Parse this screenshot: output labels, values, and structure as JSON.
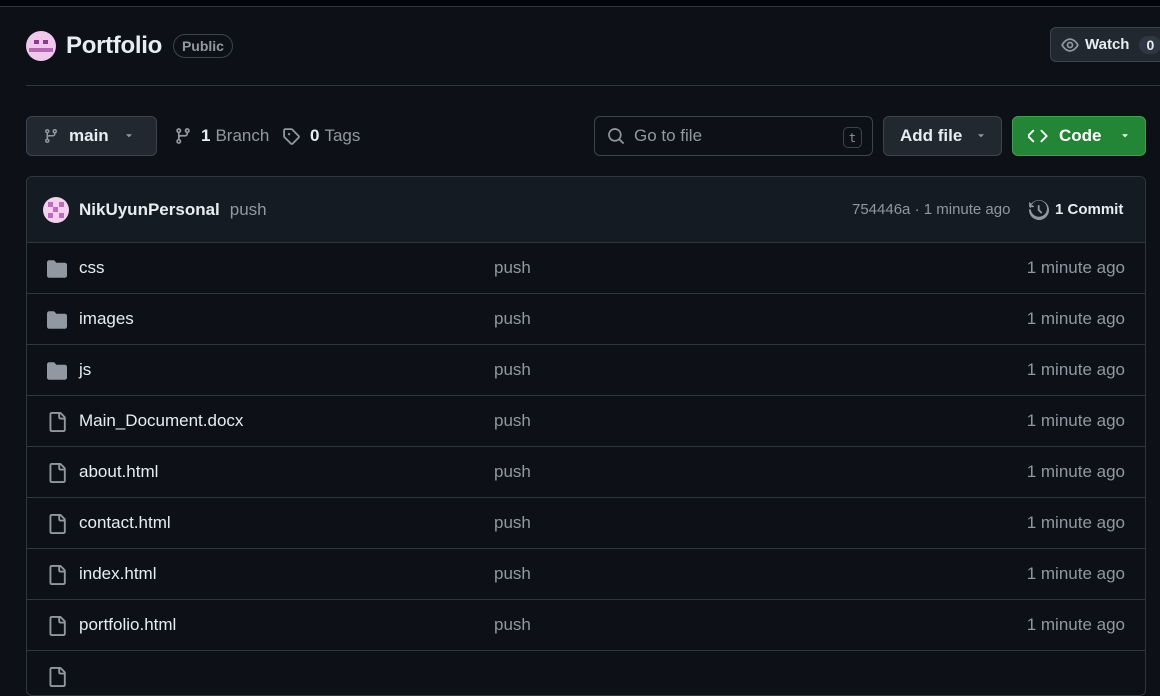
{
  "repo": {
    "name": "Portfolio",
    "visibility": "Public"
  },
  "watch": {
    "label": "Watch",
    "count": "0"
  },
  "toolbar": {
    "branch": "main",
    "branch_count": "1",
    "branch_label": "Branch",
    "tag_count": "0",
    "tag_label": "Tags",
    "search_placeholder": "Go to file",
    "search_shortcut": "t",
    "add_file_label": "Add file",
    "code_label": "Code"
  },
  "commit": {
    "author": "NikUyunPersonal",
    "message": "push",
    "hash_time": "754446a · 1 minute ago",
    "count_label": "1 Commit"
  },
  "files": [
    {
      "name": "css",
      "type": "folder",
      "message": "push",
      "time": "1 minute ago"
    },
    {
      "name": "images",
      "type": "folder",
      "message": "push",
      "time": "1 minute ago"
    },
    {
      "name": "js",
      "type": "folder",
      "message": "push",
      "time": "1 minute ago"
    },
    {
      "name": "Main_Document.docx",
      "type": "file",
      "message": "push",
      "time": "1 minute ago"
    },
    {
      "name": "about.html",
      "type": "file",
      "message": "push",
      "time": "1 minute ago"
    },
    {
      "name": "contact.html",
      "type": "file",
      "message": "push",
      "time": "1 minute ago"
    },
    {
      "name": "index.html",
      "type": "file",
      "message": "push",
      "time": "1 minute ago"
    },
    {
      "name": "portfolio.html",
      "type": "file",
      "message": "push",
      "time": "1 minute ago"
    },
    {
      "name": "",
      "type": "file",
      "message": "",
      "time": ""
    }
  ],
  "colors": {
    "background": "#0d1117",
    "code_button": "#238636",
    "muted_text": "#9198a1"
  }
}
